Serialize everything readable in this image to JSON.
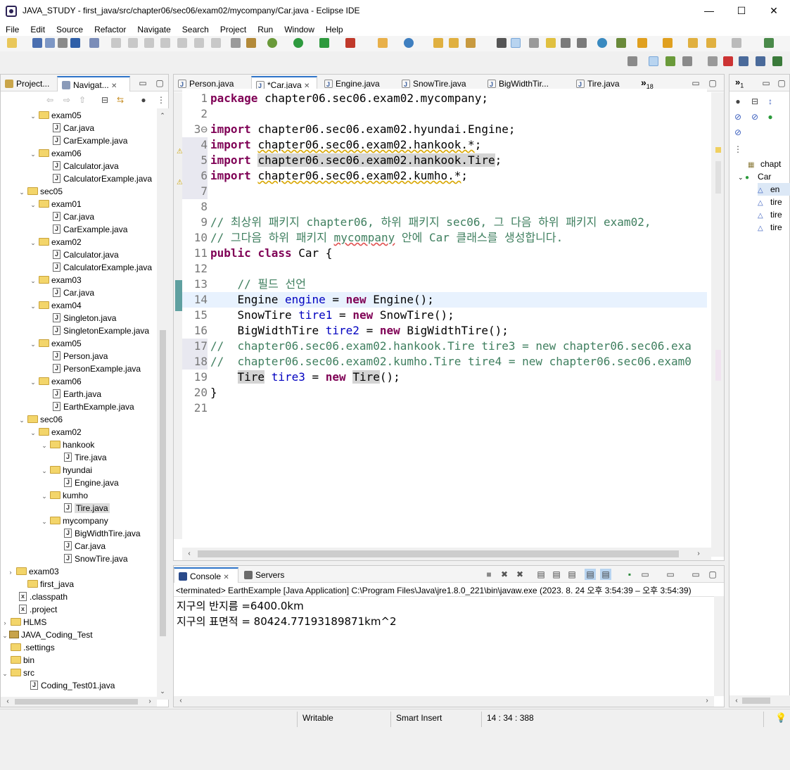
{
  "window": {
    "title": "JAVA_STUDY - first_java/src/chapter06/sec06/exam02/mycompany/Car.java - Eclipse IDE",
    "min": "—",
    "max": "☐",
    "close": "✕"
  },
  "menu": [
    "File",
    "Edit",
    "Source",
    "Refactor",
    "Navigate",
    "Search",
    "Project",
    "Run",
    "Window",
    "Help"
  ],
  "left_panel": {
    "tabs": [
      {
        "label": "Project...",
        "close": ""
      },
      {
        "label": "Navigat...",
        "close": "✕"
      }
    ],
    "tree": [
      {
        "label": "exam05",
        "icon": "folder",
        "twisty": "⌄"
      },
      {
        "label": "Car.java",
        "icon": "java"
      },
      {
        "label": "CarExample.java",
        "icon": "java"
      },
      {
        "label": "exam06",
        "icon": "folder",
        "twisty": "⌄"
      },
      {
        "label": "Calculator.java",
        "icon": "java"
      },
      {
        "label": "CalculatorExample.java",
        "icon": "java"
      },
      {
        "label": "sec05",
        "icon": "folder",
        "twisty": "⌄"
      },
      {
        "label": "exam01",
        "icon": "folder",
        "twisty": "⌄"
      },
      {
        "label": "Car.java",
        "icon": "java"
      },
      {
        "label": "CarExample.java",
        "icon": "java"
      },
      {
        "label": "exam02",
        "icon": "folder",
        "twisty": "⌄"
      },
      {
        "label": "Calculator.java",
        "icon": "java"
      },
      {
        "label": "CalculatorExample.java",
        "icon": "java"
      },
      {
        "label": "exam03",
        "icon": "folder",
        "twisty": "⌄"
      },
      {
        "label": "Car.java",
        "icon": "java"
      },
      {
        "label": "exam04",
        "icon": "folder",
        "twisty": "⌄"
      },
      {
        "label": "Singleton.java",
        "icon": "java"
      },
      {
        "label": "SingletonExample.java",
        "icon": "java"
      },
      {
        "label": "exam05",
        "icon": "folder",
        "twisty": "⌄"
      },
      {
        "label": "Person.java",
        "icon": "java"
      },
      {
        "label": "PersonExample.java",
        "icon": "java"
      },
      {
        "label": "exam06",
        "icon": "folder",
        "twisty": "⌄"
      },
      {
        "label": "Earth.java",
        "icon": "java"
      },
      {
        "label": "EarthExample.java",
        "icon": "java"
      },
      {
        "label": "sec06",
        "icon": "folder",
        "twisty": "⌄"
      },
      {
        "label": "exam02",
        "icon": "folder",
        "twisty": "⌄"
      },
      {
        "label": "hankook",
        "icon": "folder",
        "twisty": "⌄"
      },
      {
        "label": "Tire.java",
        "icon": "java"
      },
      {
        "label": "hyundai",
        "icon": "folder",
        "twisty": "⌄"
      },
      {
        "label": "Engine.java",
        "icon": "java"
      },
      {
        "label": "kumho",
        "icon": "folder",
        "twisty": "⌄"
      },
      {
        "label": "Tire.java",
        "icon": "java",
        "selected": true
      },
      {
        "label": "mycompany",
        "icon": "folder",
        "twisty": "⌄"
      },
      {
        "label": "BigWidthTire.java",
        "icon": "java"
      },
      {
        "label": "Car.java",
        "icon": "java"
      },
      {
        "label": "SnowTire.java",
        "icon": "java"
      },
      {
        "label": "exam03",
        "icon": "folder",
        "twisty": "›"
      },
      {
        "label": "first_java",
        "icon": "folder"
      },
      {
        "label": ".classpath",
        "icon": "xml"
      },
      {
        "label": ".project",
        "icon": "xml"
      },
      {
        "label": "HLMS",
        "icon": "folder",
        "twisty": "›"
      },
      {
        "label": "JAVA_Coding_Test",
        "icon": "project",
        "twisty": "⌄"
      },
      {
        "label": ".settings",
        "icon": "folder"
      },
      {
        "label": "bin",
        "icon": "folder"
      },
      {
        "label": "src",
        "icon": "folder",
        "twisty": "⌄"
      },
      {
        "label": "Coding_Test01.java",
        "icon": "java"
      }
    ]
  },
  "editor": {
    "tabs": [
      {
        "label": "Person.java",
        "close": ""
      },
      {
        "label": "*Car.java",
        "close": "✕"
      },
      {
        "label": "Engine.java",
        "close": ""
      },
      {
        "label": "SnowTire.java",
        "close": ""
      },
      {
        "label": "BigWidthTir...",
        "close": ""
      },
      {
        "label": "Tire.java",
        "close": ""
      }
    ],
    "overflow_label": "»",
    "overflow_count": "18",
    "lines": [
      {
        "n": "1",
        "t": "package chapter06.sec06.exam02.mycompany;"
      },
      {
        "n": "2",
        "t": ""
      },
      {
        "n": "3⊖",
        "t": "import chapter06.sec06.exam02.hyundai.Engine;"
      },
      {
        "n": "4",
        "t": "import chapter06.sec06.exam02.hankook.*;"
      },
      {
        "n": "5",
        "t": "import chapter06.sec06.exam02.hankook.Tire;"
      },
      {
        "n": "6",
        "t": "import chapter06.sec06.exam02.kumho.*;"
      },
      {
        "n": "7",
        "t": ""
      },
      {
        "n": "8",
        "t": ""
      },
      {
        "n": "9",
        "t": "// 최상위 패키지 chapter06, 하위 패키지 sec06, 그 다음 하위 패키지 exam02,"
      },
      {
        "n": "10",
        "t": "// 그다음 하위 패키지 mycompany 안에 Car 클래스를 생성합니다."
      },
      {
        "n": "11",
        "t": "public class Car {"
      },
      {
        "n": "12",
        "t": ""
      },
      {
        "n": "13",
        "t": "    // 필드 선언"
      },
      {
        "n": "14",
        "t": "    Engine engine = new Engine();"
      },
      {
        "n": "15",
        "t": "    SnowTire tire1 = new SnowTire();"
      },
      {
        "n": "16",
        "t": "    BigWidthTire tire2 = new BigWidthTire();"
      },
      {
        "n": "17",
        "t": "//  chapter06.sec06.exam02.hankook.Tire tire3 = new chapter06.sec06.exa"
      },
      {
        "n": "18",
        "t": "//  chapter06.sec06.exam02.kumho.Tire tire4 = new chapter06.sec06.exam0"
      },
      {
        "n": "19",
        "t": "    Tire tire3 = new Tire();"
      },
      {
        "n": "20",
        "t": "}"
      },
      {
        "n": "21",
        "t": ""
      }
    ]
  },
  "outline": {
    "tab_count": "1",
    "items": [
      {
        "label": "chapt"
      },
      {
        "label": "Car"
      },
      {
        "label": "en"
      },
      {
        "label": "tire"
      },
      {
        "label": "tire"
      },
      {
        "label": "tire"
      }
    ]
  },
  "console": {
    "tabs": [
      {
        "label": "Console",
        "close": "✕"
      },
      {
        "label": "Servers",
        "close": ""
      }
    ],
    "header": "<terminated> EarthExample [Java Application] C:\\Program Files\\Java\\jre1.8.0_221\\bin\\javaw.exe  (2023. 8. 24 오후 3:54:39 – 오후 3:54:39)",
    "output": [
      "지구의 반지름 =6400.0km",
      "지구의 표면적 = 80424.77193189871km^2"
    ]
  },
  "status": {
    "writable": "Writable",
    "insert_mode": "Smart Insert",
    "position": "14 : 34 : 388"
  },
  "colors": {
    "keyword": "#7f0055",
    "comment": "#3f7f5f",
    "field": "#0000c0",
    "tab_accent": "#2e74c9",
    "selection": "#d4d4d4"
  }
}
